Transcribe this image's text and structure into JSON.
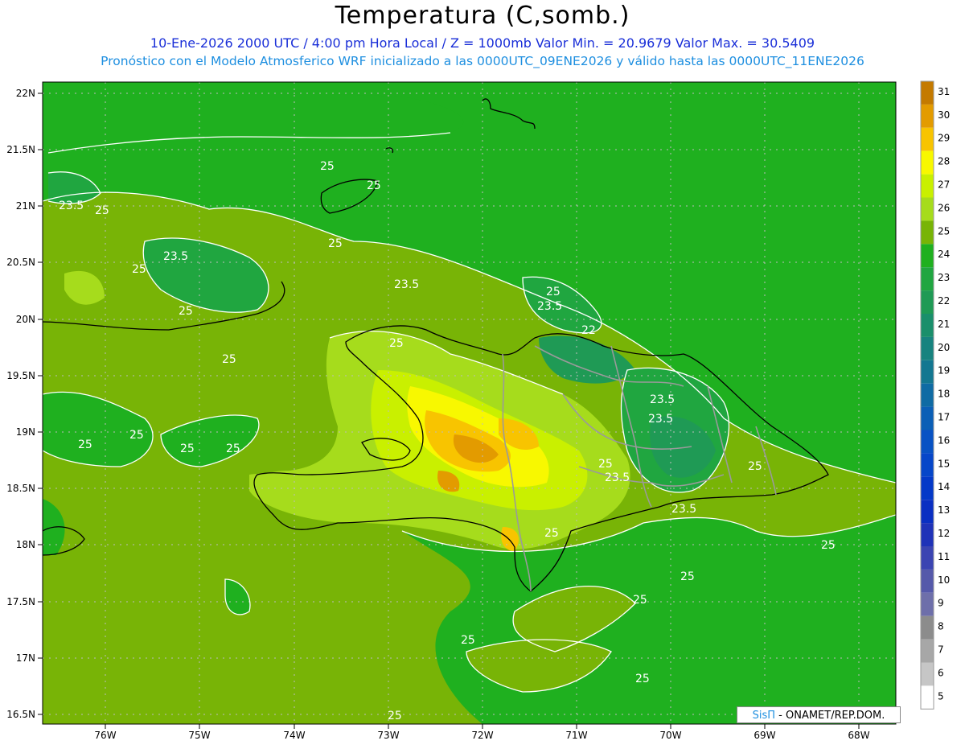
{
  "header": {
    "title": "Temperatura (C,somb.)",
    "line1": "10-Ene-2026  2000 UTC / 4:00 pm Hora Local / Z = 1000mb   Valor Min. = 20.9679  Valor Max. = 30.5409",
    "line2": "Pronóstico con el Modelo Atmosferico WRF inicializado a las 0000UTC_09ENE2026 y válido hasta las  0000UTC_11ENE2026"
  },
  "map": {
    "lat_labels": [
      "22N",
      "21.5N",
      "21N",
      "20.5N",
      "20N",
      "19.5N",
      "19N",
      "18.5N",
      "18N",
      "17.5N",
      "17N",
      "16.5N"
    ],
    "lon_labels": [
      "76W",
      "75W",
      "74W",
      "73W",
      "72W",
      "71W",
      "70W",
      "69W",
      "68W"
    ],
    "contour_labels": [
      "25",
      "25",
      "23.5",
      "25",
      "25",
      "23.5",
      "25",
      "25",
      "25",
      "25",
      "23.5",
      "23.5",
      "22",
      "25",
      "23.5",
      "23.5",
      "25",
      "25",
      "25",
      "25",
      "25",
      "23.5",
      "25",
      "23.5",
      "25",
      "25",
      "25",
      "25",
      "25",
      "25",
      "25"
    ]
  },
  "colorbar": {
    "labels": [
      "31",
      "30",
      "29",
      "28",
      "27",
      "26",
      "25",
      "24",
      "23",
      "22",
      "21",
      "20",
      "19",
      "18",
      "17",
      "16",
      "15",
      "14",
      "13",
      "12",
      "11",
      "10",
      "9",
      "8",
      "7",
      "6",
      "5"
    ],
    "colors": [
      "#c47a00",
      "#e39b00",
      "#f8c400",
      "#f8f800",
      "#c9f000",
      "#a6dc1c",
      "#78b406",
      "#1fb01f",
      "#20a640",
      "#1f9a55",
      "#1a8f6b",
      "#17837f",
      "#137791",
      "#0f6ba4",
      "#0b5fb6",
      "#0852c4",
      "#0646c9",
      "#0439c8",
      "#0a2fc2",
      "#1f32b8",
      "#3b44b2",
      "#5559aa",
      "#6e6faa",
      "#8c8c8c",
      "#a7a7a7",
      "#c6c6c6",
      "#ffffff"
    ]
  },
  "credit": {
    "sis": "SisΠ",
    "org": " - ONAMET/REP.DOM."
  }
}
